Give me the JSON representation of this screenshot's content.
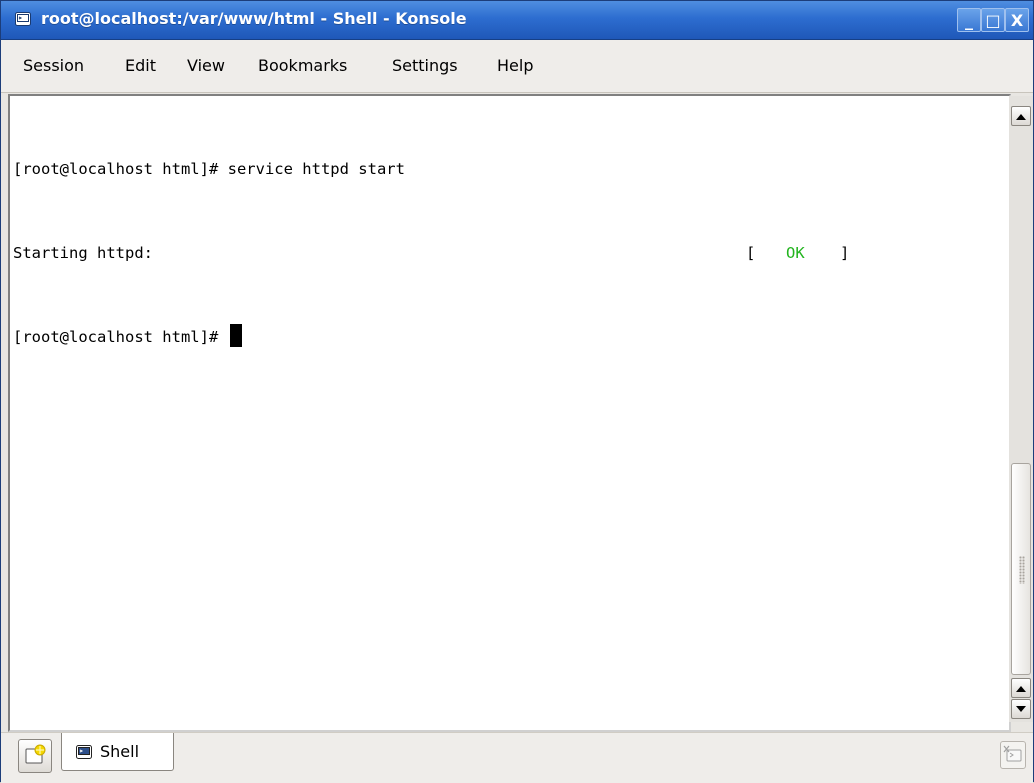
{
  "window": {
    "title": "root@localhost:/var/www/html - Shell - Konsole",
    "icon": "konsole-icon",
    "buttons": {
      "minimize": "_",
      "maximize": "□",
      "close": "X"
    },
    "accent_color": "#2d6dd0"
  },
  "menubar": {
    "items": [
      "Session",
      "Edit",
      "View",
      "Bookmarks",
      "Settings",
      "Help"
    ]
  },
  "terminal": {
    "lines": [
      {
        "text": "[root@localhost html]# service httpd start"
      },
      {
        "text": "Starting httpd:",
        "status": {
          "open": "[",
          "value": "OK",
          "close": "]",
          "color": "#22b41e"
        }
      },
      {
        "text": "[root@localhost html]# ",
        "cursor": true
      }
    ]
  },
  "tabbar": {
    "tabs": [
      {
        "label": "Shell",
        "icon": "konsole-icon"
      }
    ],
    "new_tab_icon": "new-tab-icon",
    "close_tab_icon": "close-session-icon"
  }
}
